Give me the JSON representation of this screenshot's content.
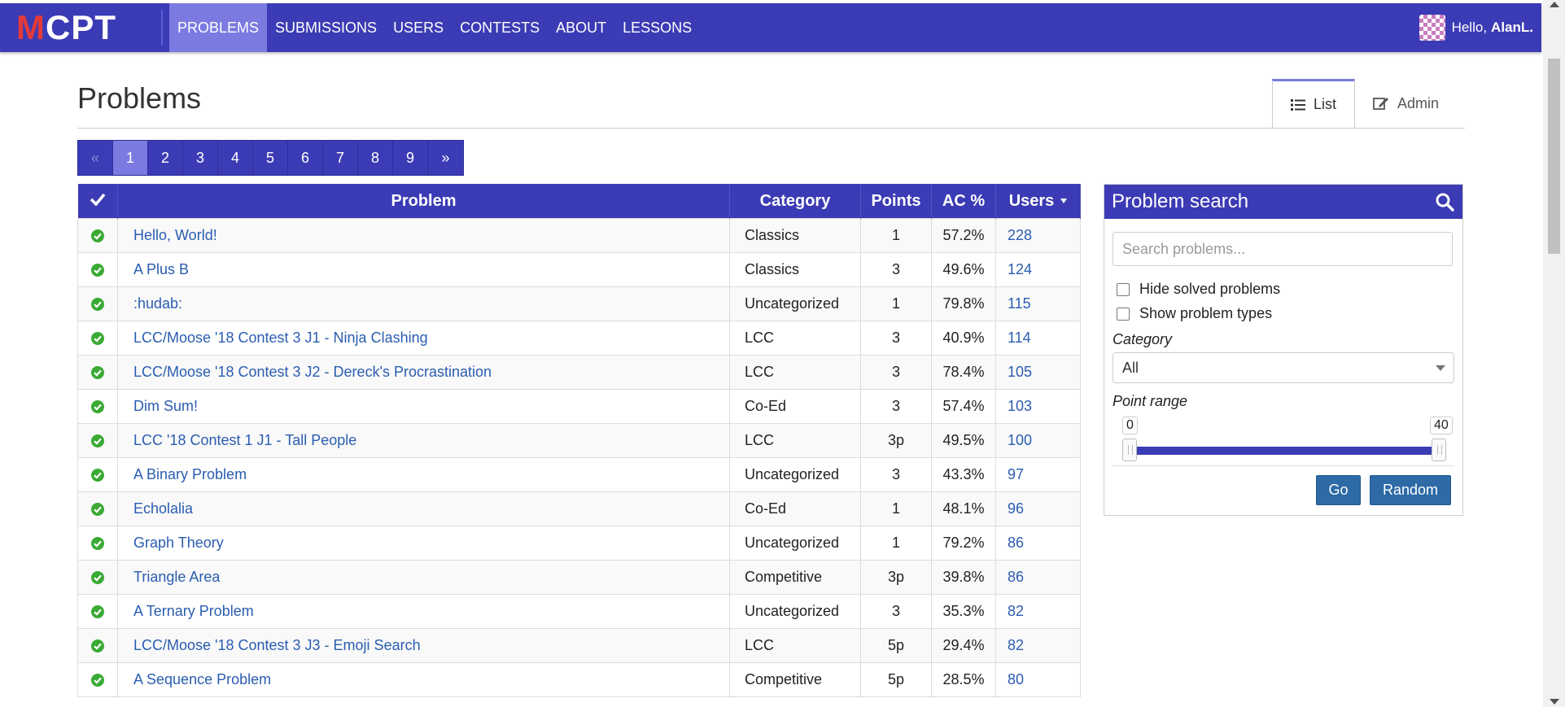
{
  "navbar": {
    "logo_m": "M",
    "logo_rest": "CPT",
    "items": [
      {
        "label": "PROBLEMS",
        "active": true
      },
      {
        "label": "SUBMISSIONS",
        "active": false
      },
      {
        "label": "USERS",
        "active": false
      },
      {
        "label": "CONTESTS",
        "active": false
      },
      {
        "label": "ABOUT",
        "active": false
      },
      {
        "label": "LESSONS",
        "active": false
      }
    ],
    "greeting": "Hello,",
    "username": "AlanL."
  },
  "page": {
    "title": "Problems",
    "tabs": [
      {
        "label": "List",
        "icon": "list-icon",
        "active": true
      },
      {
        "label": "Admin",
        "icon": "edit-icon",
        "active": false
      }
    ]
  },
  "pagination": {
    "prev": "«",
    "next": "»",
    "pages": [
      "1",
      "2",
      "3",
      "4",
      "5",
      "6",
      "7",
      "8",
      "9"
    ],
    "current": "1"
  },
  "table": {
    "headers": {
      "solved": "check-icon",
      "problem": "Problem",
      "category": "Category",
      "points": "Points",
      "ac": "AC %",
      "users": "Users"
    },
    "rows": [
      {
        "name": "Hello, World!",
        "category": "Classics",
        "points": "1",
        "ac": "57.2%",
        "users": "228"
      },
      {
        "name": "A Plus B",
        "category": "Classics",
        "points": "3",
        "ac": "49.6%",
        "users": "124"
      },
      {
        "name": ":hudab:",
        "category": "Uncategorized",
        "points": "1",
        "ac": "79.8%",
        "users": "115"
      },
      {
        "name": "LCC/Moose '18 Contest 3 J1 - Ninja Clashing",
        "category": "LCC",
        "points": "3",
        "ac": "40.9%",
        "users": "114"
      },
      {
        "name": "LCC/Moose '18 Contest 3 J2 - Dereck's Procrastination",
        "category": "LCC",
        "points": "3",
        "ac": "78.4%",
        "users": "105"
      },
      {
        "name": "Dim Sum!",
        "category": "Co-Ed",
        "points": "3",
        "ac": "57.4%",
        "users": "103"
      },
      {
        "name": "LCC '18 Contest 1 J1 - Tall People",
        "category": "LCC",
        "points": "3p",
        "ac": "49.5%",
        "users": "100"
      },
      {
        "name": "A Binary Problem",
        "category": "Uncategorized",
        "points": "3",
        "ac": "43.3%",
        "users": "97"
      },
      {
        "name": "Echolalia",
        "category": "Co-Ed",
        "points": "1",
        "ac": "48.1%",
        "users": "96"
      },
      {
        "name": "Graph Theory",
        "category": "Uncategorized",
        "points": "1",
        "ac": "79.2%",
        "users": "86"
      },
      {
        "name": "Triangle Area",
        "category": "Competitive",
        "points": "3p",
        "ac": "39.8%",
        "users": "86"
      },
      {
        "name": "A Ternary Problem",
        "category": "Uncategorized",
        "points": "3",
        "ac": "35.3%",
        "users": "82"
      },
      {
        "name": "LCC/Moose '18 Contest 3 J3 - Emoji Search",
        "category": "LCC",
        "points": "5p",
        "ac": "29.4%",
        "users": "82"
      },
      {
        "name": "A Sequence Problem",
        "category": "Competitive",
        "points": "5p",
        "ac": "28.5%",
        "users": "80"
      }
    ]
  },
  "search": {
    "title": "Problem search",
    "placeholder": "Search problems...",
    "hide_solved": "Hide solved problems",
    "show_types": "Show problem types",
    "category_label": "Category",
    "category_value": "All",
    "point_range_label": "Point range",
    "range_min": "0",
    "range_max": "40",
    "go": "Go",
    "random": "Random"
  },
  "colors": {
    "primary": "#3b3bb5",
    "active": "#7a7ae0",
    "link": "#2a5db0",
    "success": "#3aaa35",
    "button": "#2d6aa6"
  }
}
